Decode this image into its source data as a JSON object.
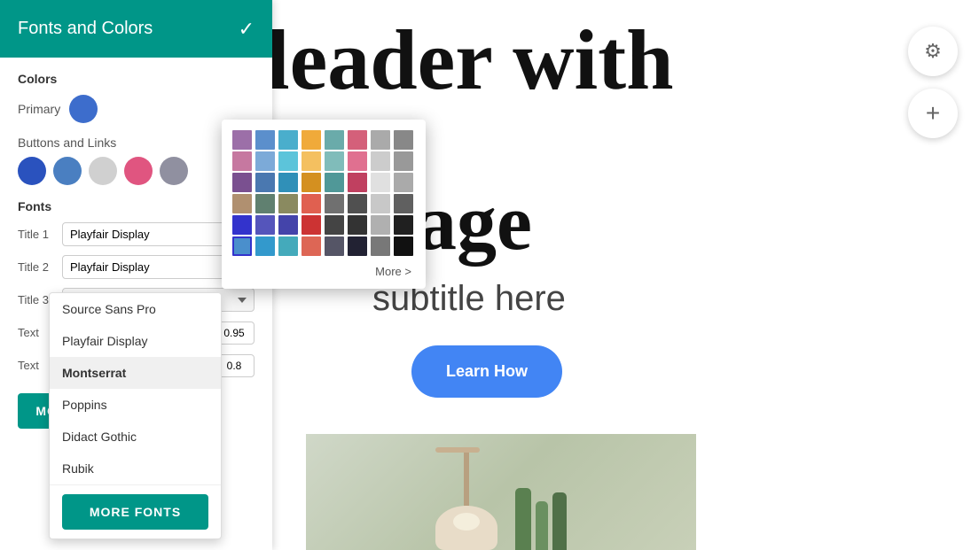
{
  "header": {
    "title": "Fonts and Colors",
    "check_icon": "✓",
    "bg_color": "#009688"
  },
  "sidebar": {
    "colors_label": "Colors",
    "primary_label": "Primary",
    "primary_color": "#3d6dcc",
    "buttons_links_label": "Buttons and  Links",
    "button_colors": [
      {
        "color": "#2a52be",
        "name": "dark-blue"
      },
      {
        "color": "#4a7fc1",
        "name": "medium-blue"
      },
      {
        "color": "#d0d0d0",
        "name": "light-gray"
      },
      {
        "color": "#e05580",
        "name": "pink-red"
      },
      {
        "color": "#9090a0",
        "name": "dark-gray"
      }
    ],
    "fonts_label": "Fonts",
    "font_rows": [
      {
        "label": "Title 1",
        "font": "Playfair Display",
        "size": null
      },
      {
        "label": "Title 2",
        "font": "Playfair Display",
        "size": null
      },
      {
        "label": "Title 3",
        "font": "Montserrat",
        "size": null
      },
      {
        "label": "Text",
        "font": "Source Sans Pro",
        "size": "0.95"
      },
      {
        "label": "Text",
        "font": "Playfair Display",
        "size": "0.8"
      }
    ],
    "more_fonts_label": "MORE FONTS"
  },
  "color_picker": {
    "more_label": "More >",
    "colors": [
      "#9c6fa8",
      "#5b8fcc",
      "#4aaecc",
      "#f0aa3a",
      "#6aabaa",
      "#d4607a",
      "#aaaaaa",
      "#888888",
      "#c678a0",
      "#7caad8",
      "#5cc4da",
      "#f4c060",
      "#80bcba",
      "#e07090",
      "#cccccc",
      "#999999",
      "#7a5090",
      "#4a78b0",
      "#3090b8",
      "#d49020",
      "#509898",
      "#c04060",
      "#e0e0e0",
      "#aaaaaa",
      "#b09070",
      "#608070",
      "#8a8a60",
      "#e06050",
      "#707070",
      "#505050",
      "#c8c8c8",
      "#606060",
      "#3333cc",
      "#5555bb",
      "#4444aa",
      "#cc3333",
      "#444444",
      "#333333",
      "#b0b0b0",
      "#202020",
      "#4466cc",
      "#3399cc",
      "#44aabb",
      "#dd6655",
      "#555566",
      "#222233",
      "#787878",
      "#111111"
    ]
  },
  "font_dropdown": {
    "options": [
      {
        "label": "Source Sans Pro",
        "selected": false
      },
      {
        "label": "Playfair Display",
        "selected": false
      },
      {
        "label": "Montserrat",
        "selected": true
      },
      {
        "label": "Poppins",
        "selected": false
      },
      {
        "label": "Didact Gothic",
        "selected": false
      },
      {
        "label": "Rubik",
        "selected": false
      }
    ]
  },
  "preview": {
    "heading_text": "leader with",
    "subheading_text": "nage",
    "subtitle_text": " subtitle here",
    "learn_how_label": "Learn How",
    "learn_how_color": "#4285f4"
  },
  "settings": {
    "gear_icon": "⚙",
    "plus_icon": "+"
  }
}
